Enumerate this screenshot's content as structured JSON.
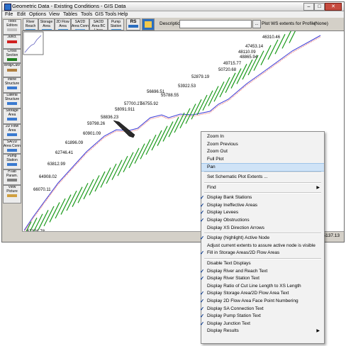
{
  "window": {
    "title": "Geometric Data - Existing Conditions - GIS Data",
    "controls": [
      "–",
      "□",
      "✕"
    ]
  },
  "menu": [
    "File",
    "Edit",
    "Options",
    "View",
    "Tables",
    "Tools",
    "GIS Tools",
    "Help"
  ],
  "toolbar": {
    "buttons": [
      {
        "label": "River Reach",
        "color": "#3a8fd8"
      },
      {
        "label": "Storage Area",
        "color": "#3a8fd8"
      },
      {
        "label": "2D Flow Area",
        "color": "#3a8fd8"
      },
      {
        "label": "SA/2D Area Conn",
        "color": "#5aa0e0"
      },
      {
        "label": "SA/2D Area BC Lines",
        "color": "#5aa0e0"
      },
      {
        "label": "Pump Station",
        "color": "#3a8fd8"
      },
      {
        "label": "RS",
        "color": "#2a6ec0"
      },
      {
        "label": "",
        "color": "#2a6ec0"
      }
    ],
    "description_label": "Description :",
    "description_value": "",
    "description_button": "...",
    "plot_ws_label": "Plot WS extents for Profile:",
    "profile_value": "(None)"
  },
  "sidebar": [
    {
      "label": "Tools Editors",
      "color": "#c0c0c0"
    },
    {
      "label": "Junct.",
      "color": "#d02020"
    },
    {
      "label": "Cross Section",
      "color": "#208020"
    },
    {
      "label": "Brdg/Culv",
      "color": "#b08040"
    },
    {
      "label": "Inline Structure",
      "color": "#3a7ad0"
    },
    {
      "label": "Lateral Structure",
      "color": "#3a7ad0"
    },
    {
      "label": "Storage Area",
      "color": "#3a7ad0"
    },
    {
      "label": "2D Flow Area",
      "color": "#3a7ad0"
    },
    {
      "label": "SA/2D Area Conn",
      "color": "#3a7ad0"
    },
    {
      "label": "Pump Station",
      "color": "#3a7ad0"
    },
    {
      "label": "HTab Param.",
      "color": "#808080"
    },
    {
      "label": "View Picture",
      "color": "#d0a040"
    }
  ],
  "chart_data": {
    "type": "scatter",
    "river_stations": [
      "67326.78",
      "66070.11",
      "64908.02",
      "63812.99",
      "62746.41",
      "61896.09",
      "60901.09",
      "59798.26",
      "58836.23",
      "58091.911",
      "57700.27",
      "56755.92",
      "56696.51",
      "55788.55",
      "53922.53",
      "52879.19",
      "50720.68",
      "49715.77",
      "48865.94",
      "48110.09",
      "47453.14",
      "46310.46"
    ]
  },
  "status": {
    "coordinate": "5137.13"
  },
  "context_menu": {
    "items": [
      {
        "label": "Zoom In",
        "checked": false,
        "highlight": false,
        "arrow": false
      },
      {
        "label": "Zoom Previous",
        "checked": false,
        "highlight": false,
        "arrow": false
      },
      {
        "label": "Zoom Out",
        "checked": false,
        "highlight": false,
        "arrow": false
      },
      {
        "label": "Full Plot",
        "checked": false,
        "highlight": false,
        "arrow": false
      },
      {
        "label": "Pan",
        "checked": false,
        "highlight": true,
        "arrow": false
      },
      {
        "sep": true
      },
      {
        "label": "Set Schematic Plot Extents ...",
        "checked": false,
        "highlight": false,
        "arrow": false
      },
      {
        "sep": true
      },
      {
        "label": "Find",
        "checked": false,
        "highlight": false,
        "arrow": true
      },
      {
        "sep": true
      },
      {
        "label": "Display Bank Stations",
        "checked": true,
        "highlight": false,
        "arrow": false
      },
      {
        "label": "Display Ineffective Areas",
        "checked": true,
        "highlight": false,
        "arrow": false
      },
      {
        "label": "Display Levees",
        "checked": true,
        "highlight": false,
        "arrow": false
      },
      {
        "label": "Display Obstructions",
        "checked": true,
        "highlight": false,
        "arrow": false
      },
      {
        "label": "Display XS Direction Arrows",
        "checked": false,
        "highlight": false,
        "arrow": false
      },
      {
        "sep": true
      },
      {
        "label": "Display (highlight) Active Node",
        "checked": true,
        "highlight": false,
        "arrow": false
      },
      {
        "label": "Adjust current extents to assure active node is visible",
        "checked": false,
        "highlight": false,
        "arrow": false
      },
      {
        "label": "Fill in Storage Areas/2D Flow Areas",
        "checked": true,
        "highlight": false,
        "arrow": false
      },
      {
        "sep": true
      },
      {
        "label": "Disable Text Displays",
        "checked": false,
        "highlight": false,
        "arrow": false
      },
      {
        "label": "Display River and Reach Text",
        "checked": true,
        "highlight": false,
        "arrow": false
      },
      {
        "label": "Display River Station Text",
        "checked": true,
        "highlight": false,
        "arrow": false
      },
      {
        "label": "Display Ratio of Cut Line Length to XS Length",
        "checked": false,
        "highlight": false,
        "arrow": false
      },
      {
        "label": "Display Storage Area/2D Flow Area Text",
        "checked": true,
        "highlight": false,
        "arrow": false
      },
      {
        "label": "Display 2D Flow Area Face Point Numbering",
        "checked": true,
        "highlight": false,
        "arrow": false
      },
      {
        "label": "Display SA Connection Text",
        "checked": true,
        "highlight": false,
        "arrow": false
      },
      {
        "label": "Display Pump Station Text",
        "checked": true,
        "highlight": false,
        "arrow": false
      },
      {
        "label": "Display Junction Text",
        "checked": true,
        "highlight": false,
        "arrow": false
      },
      {
        "label": "Display Results",
        "checked": false,
        "highlight": false,
        "arrow": true
      }
    ]
  }
}
